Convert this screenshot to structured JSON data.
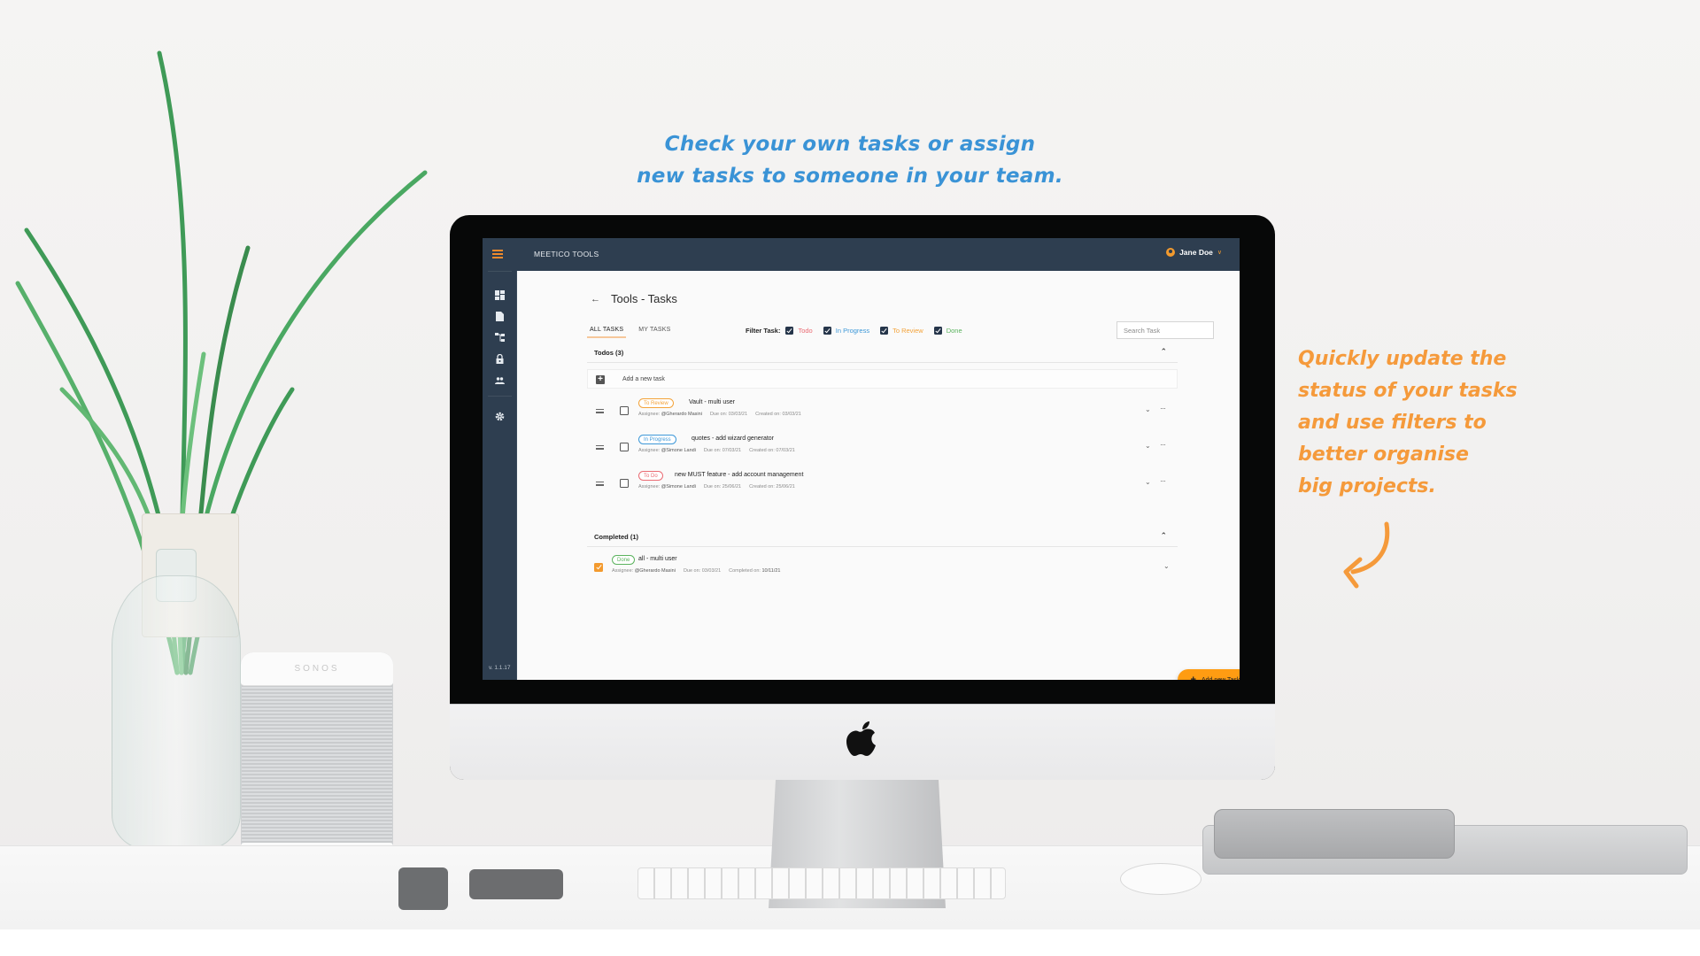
{
  "marketing": {
    "headline_line1": "Check your own tasks or assign",
    "headline_line2": "new tasks to someone in your team.",
    "side_note_lines": [
      "Quickly update the",
      "status of your tasks",
      "and use filters to",
      "better organise",
      "big projects."
    ],
    "headline_color": "#3a93d6",
    "side_note_color": "#f59a3b"
  },
  "app": {
    "title": "MEETICO TOOLS",
    "user_name": "Jane Doe",
    "version": "v. 1.1.17",
    "brand_color": "#2e3e50",
    "accent_color": "#f39a2e",
    "sidebar": {
      "items": [
        {
          "icon": "dashboard-icon"
        },
        {
          "icon": "document-icon"
        },
        {
          "icon": "hierarchy-icon"
        },
        {
          "icon": "lock-icon"
        },
        {
          "icon": "people-icon"
        },
        {
          "icon": "gear-icon"
        }
      ]
    },
    "page_title": "Tools - Tasks",
    "tabs": [
      {
        "label": "ALL TASKS",
        "active": true
      },
      {
        "label": "MY TASKS",
        "active": false
      }
    ],
    "filter": {
      "label": "Filter Task:",
      "options": [
        {
          "label": "Todo",
          "checked": true,
          "color": "#ea6b73"
        },
        {
          "label": "In Progress",
          "checked": true,
          "color": "#3d98d8"
        },
        {
          "label": "To Review",
          "checked": true,
          "color": "#f3a33a"
        },
        {
          "label": "Done",
          "checked": true,
          "color": "#5bb35e"
        }
      ]
    },
    "search": {
      "placeholder": "Search Task",
      "value": ""
    },
    "todos": {
      "title": "Todos (3)",
      "add_label": "Add a new task",
      "tasks": [
        {
          "status": "To Review",
          "status_color": "#f3a33a",
          "title": "Vault - multi user",
          "assignee_label": "Assignee:",
          "assignee": "@Gherardo Masini",
          "due_label": "Due on:",
          "due": "03/03/21",
          "created_label": "Created on:",
          "created": "03/03/21",
          "done": false
        },
        {
          "status": "In Progress",
          "status_color": "#3d98d8",
          "title": "quotes - add wizard generator",
          "assignee_label": "Assignee:",
          "assignee": "@Simone Landi",
          "due_label": "Due on:",
          "due": "07/03/21",
          "created_label": "Created on:",
          "created": "07/03/21",
          "done": false
        },
        {
          "status": "To Do",
          "status_color": "#ea6b73",
          "title": "new MUST feature - add account management",
          "assignee_label": "Assignee:",
          "assignee": "@Simone Landi",
          "due_label": "Due on:",
          "due": "25/06/21",
          "created_label": "Created on:",
          "created": "25/06/21",
          "done": false
        }
      ]
    },
    "completed": {
      "title": "Completed (1)",
      "tasks": [
        {
          "status": "Done",
          "status_color": "#5bb35e",
          "title": "all - multi user",
          "assignee_label": "Assignee:",
          "assignee": "@Gherardo Masini",
          "due_label": "Due on:",
          "due": "03/03/21",
          "completed_label": "Completed on:",
          "completed": "10/11/21",
          "done": true
        }
      ]
    },
    "fab_label": "Add new Task"
  },
  "scene": {
    "speaker_brand": "SONOS"
  }
}
